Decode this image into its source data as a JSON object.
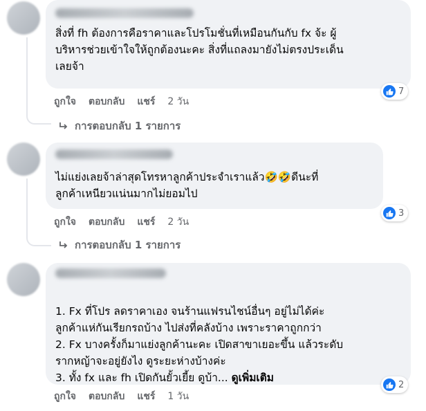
{
  "comments": [
    {
      "text": "สิ่งที่ fh ต้องการคือราคาและโปรโมชั่นที่เหมือนกันกับ fx จ้ะ ผู้\nบริหารช่วยเข้าใจให้ถูกต้องนะคะ สิ่งที่แถลงมายังไม่ตรงประเด็น\nเลยจ้า",
      "see_more": "",
      "reaction_count": "7",
      "like": "ถูกใจ",
      "reply": "ตอบกลับ",
      "share": "แชร์",
      "time": "2 วัน",
      "replies_label": "การตอบกลับ 1 รายการ"
    },
    {
      "text": "ไม่แย่งเลยจ้าล่าสุดโทรหาลูกค้าประจำเราแล้ว🤣🤣ดีนะที่\nลูกค้าเหนียวแน่นมากไม่ยอมไป",
      "see_more": "",
      "reaction_count": "3",
      "like": "ถูกใจ",
      "reply": "ตอบกลับ",
      "share": "แชร์",
      "time": "2 วัน",
      "replies_label": "การตอบกลับ 1 รายการ"
    },
    {
      "text": "1. Fx ที่โปร ลดราคาเอง จนร้านแฟรนไชน์อื่นๆ อยู่ไม่ได้ค่ะ\nลูกค้าแห่กันเรียกรถบ้าง ไปส่งที่คลังบ้าง เพราะราคาถูกกว่า\n2. Fx บางครั้งก็มาแย่งลูกค้านะคะ เปิดสาขาเยอะขึ้น แล้วระดับ\nรากหญ้าจะอยู่ยังไง ดูระยะห่างบ้างค่ะ\n3. ทั้ง fx และ fh เปิดกันยั้วเยี้ย ดูบ้า... ",
      "see_more": "ดูเพิ่มเติม",
      "reaction_count": "2",
      "like": "ถูกใจ",
      "reply": "ตอบกลับ",
      "share": "แชร์",
      "time": "1 วัน",
      "replies_label": ""
    }
  ],
  "colors": {
    "bubble": "#f0f2f5",
    "meta": "#65676b",
    "like_blue": "#1877f2"
  },
  "icons": {
    "reaction": "thumbs-up-icon",
    "reply_arrow": "reply-arrow-icon"
  }
}
